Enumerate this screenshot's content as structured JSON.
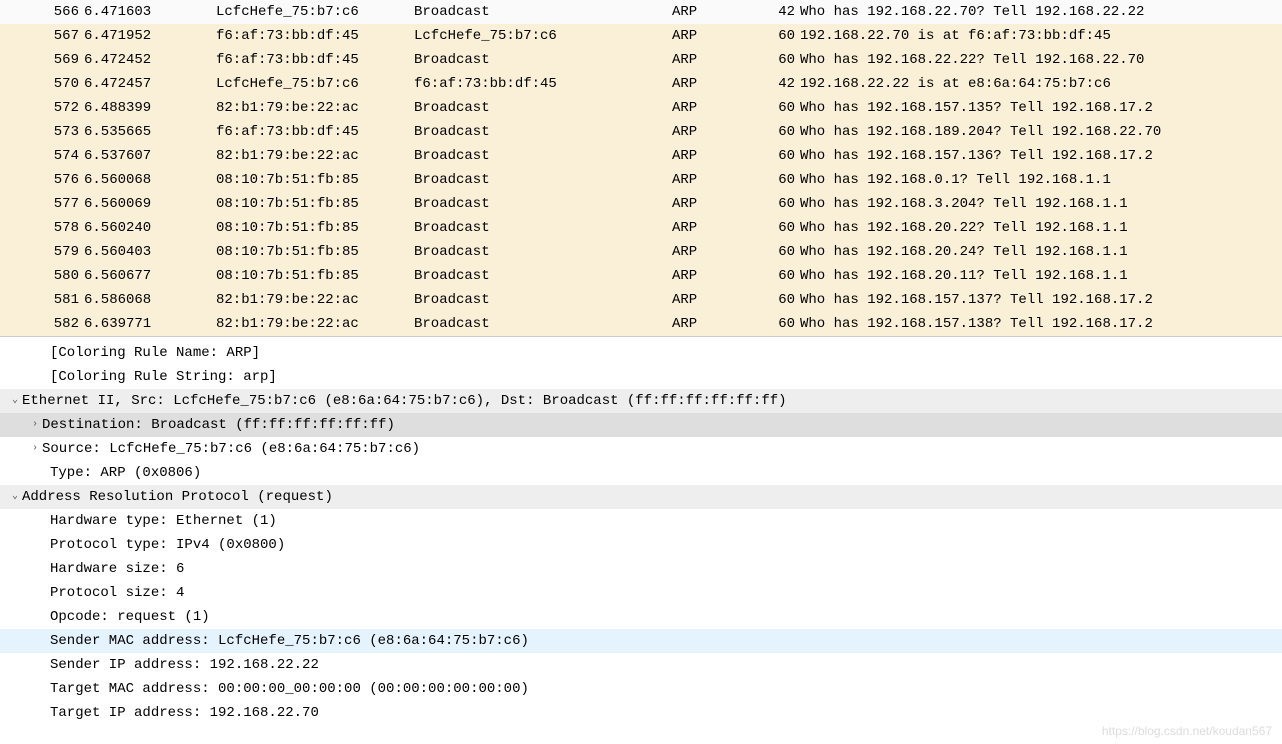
{
  "packets": [
    {
      "no": "566",
      "time": "6.471603",
      "src": "LcfcHefe_75:b7:c6",
      "dst": "Broadcast",
      "proto": "ARP",
      "len": "42",
      "info": "Who has 192.168.22.70? Tell 192.168.22.22",
      "style": "normal"
    },
    {
      "no": "567",
      "time": "6.471952",
      "src": "f6:af:73:bb:df:45",
      "dst": "LcfcHefe_75:b7:c6",
      "proto": "ARP",
      "len": "60",
      "info": "192.168.22.70 is at f6:af:73:bb:df:45",
      "style": "arp"
    },
    {
      "no": "569",
      "time": "6.472452",
      "src": "f6:af:73:bb:df:45",
      "dst": "Broadcast",
      "proto": "ARP",
      "len": "60",
      "info": "Who has 192.168.22.22? Tell 192.168.22.70",
      "style": "arp"
    },
    {
      "no": "570",
      "time": "6.472457",
      "src": "LcfcHefe_75:b7:c6",
      "dst": "f6:af:73:bb:df:45",
      "proto": "ARP",
      "len": "42",
      "info": "192.168.22.22 is at e8:6a:64:75:b7:c6",
      "style": "arp"
    },
    {
      "no": "572",
      "time": "6.488399",
      "src": "82:b1:79:be:22:ac",
      "dst": "Broadcast",
      "proto": "ARP",
      "len": "60",
      "info": "Who has 192.168.157.135? Tell 192.168.17.2",
      "style": "arp"
    },
    {
      "no": "573",
      "time": "6.535665",
      "src": "f6:af:73:bb:df:45",
      "dst": "Broadcast",
      "proto": "ARP",
      "len": "60",
      "info": "Who has 192.168.189.204? Tell 192.168.22.70",
      "style": "arp"
    },
    {
      "no": "574",
      "time": "6.537607",
      "src": "82:b1:79:be:22:ac",
      "dst": "Broadcast",
      "proto": "ARP",
      "len": "60",
      "info": "Who has 192.168.157.136? Tell 192.168.17.2",
      "style": "arp"
    },
    {
      "no": "576",
      "time": "6.560068",
      "src": "08:10:7b:51:fb:85",
      "dst": "Broadcast",
      "proto": "ARP",
      "len": "60",
      "info": "Who has 192.168.0.1? Tell 192.168.1.1",
      "style": "arp"
    },
    {
      "no": "577",
      "time": "6.560069",
      "src": "08:10:7b:51:fb:85",
      "dst": "Broadcast",
      "proto": "ARP",
      "len": "60",
      "info": "Who has 192.168.3.204? Tell 192.168.1.1",
      "style": "arp"
    },
    {
      "no": "578",
      "time": "6.560240",
      "src": "08:10:7b:51:fb:85",
      "dst": "Broadcast",
      "proto": "ARP",
      "len": "60",
      "info": "Who has 192.168.20.22? Tell 192.168.1.1",
      "style": "arp"
    },
    {
      "no": "579",
      "time": "6.560403",
      "src": "08:10:7b:51:fb:85",
      "dst": "Broadcast",
      "proto": "ARP",
      "len": "60",
      "info": "Who has 192.168.20.24? Tell 192.168.1.1",
      "style": "arp"
    },
    {
      "no": "580",
      "time": "6.560677",
      "src": "08:10:7b:51:fb:85",
      "dst": "Broadcast",
      "proto": "ARP",
      "len": "60",
      "info": "Who has 192.168.20.11? Tell 192.168.1.1",
      "style": "arp"
    },
    {
      "no": "581",
      "time": "6.586068",
      "src": "82:b1:79:be:22:ac",
      "dst": "Broadcast",
      "proto": "ARP",
      "len": "60",
      "info": "Who has 192.168.157.137? Tell 192.168.17.2",
      "style": "arp"
    },
    {
      "no": "582",
      "time": "6.639771",
      "src": "82:b1:79:be:22:ac",
      "dst": "Broadcast",
      "proto": "ARP",
      "len": "60",
      "info": "Who has 192.168.157.138? Tell 192.168.17.2",
      "style": "arp"
    }
  ],
  "details": {
    "coloring_name": "[Coloring Rule Name: ARP]",
    "coloring_string": "[Coloring Rule String: arp]",
    "eth_header": "Ethernet II, Src: LcfcHefe_75:b7:c6 (e8:6a:64:75:b7:c6), Dst: Broadcast (ff:ff:ff:ff:ff:ff)",
    "eth_dst": "Destination: Broadcast (ff:ff:ff:ff:ff:ff)",
    "eth_src": "Source: LcfcHefe_75:b7:c6 (e8:6a:64:75:b7:c6)",
    "eth_type": "Type: ARP (0x0806)",
    "arp_header": "Address Resolution Protocol (request)",
    "arp_hw_type": "Hardware type: Ethernet (1)",
    "arp_proto_type": "Protocol type: IPv4 (0x0800)",
    "arp_hw_size": "Hardware size: 6",
    "arp_proto_size": "Protocol size: 4",
    "arp_opcode": "Opcode: request (1)",
    "arp_sender_mac": "Sender MAC address: LcfcHefe_75:b7:c6 (e8:6a:64:75:b7:c6)",
    "arp_sender_ip": "Sender IP address: 192.168.22.22",
    "arp_target_mac": "Target MAC address: 00:00:00_00:00:00 (00:00:00:00:00:00)",
    "arp_target_ip": "Target IP address: 192.168.22.70"
  },
  "watermark": "https://blog.csdn.net/koudan567"
}
